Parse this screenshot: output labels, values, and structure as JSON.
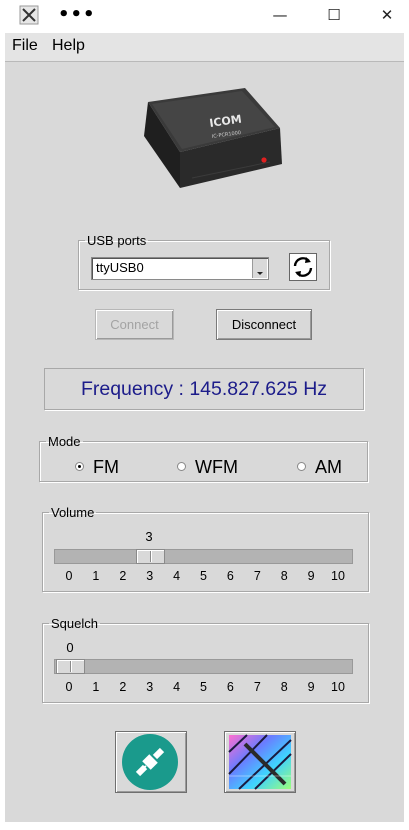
{
  "window": {
    "overflow_menu": "•••",
    "minimize": "—",
    "maximize": "☐",
    "close": "✕"
  },
  "menu": {
    "file": "File",
    "help": "Help"
  },
  "device_image": {
    "brand": "ICOM",
    "model": "IC-PCR1000"
  },
  "usb": {
    "legend": "USB ports",
    "selected_port": "ttyUSB0",
    "refresh_icon": "refresh-icon"
  },
  "buttons": {
    "connect": "Connect",
    "connect_enabled": false,
    "disconnect": "Disconnect"
  },
  "frequency": {
    "text": "Frequency : 145.827.625 Hz"
  },
  "mode": {
    "legend": "Mode",
    "options": [
      {
        "label": "FM",
        "selected": true
      },
      {
        "label": "WFM",
        "selected": false
      },
      {
        "label": "AM",
        "selected": false
      }
    ]
  },
  "volume": {
    "legend": "Volume",
    "value": "3",
    "ticks": [
      "0",
      "1",
      "2",
      "3",
      "4",
      "5",
      "6",
      "7",
      "8",
      "9",
      "10"
    ]
  },
  "squelch": {
    "legend": "Squelch",
    "value": "0",
    "ticks": [
      "0",
      "1",
      "2",
      "3",
      "4",
      "5",
      "6",
      "7",
      "8",
      "9",
      "10"
    ]
  },
  "colors": {
    "frequency_text": "#1c1c8a",
    "panel_bg": "#d9d9d9",
    "icon_teal": "#1a9a8c"
  },
  "icons": {
    "satellite_button": "satellite-icon",
    "map_button": "map-icon"
  }
}
